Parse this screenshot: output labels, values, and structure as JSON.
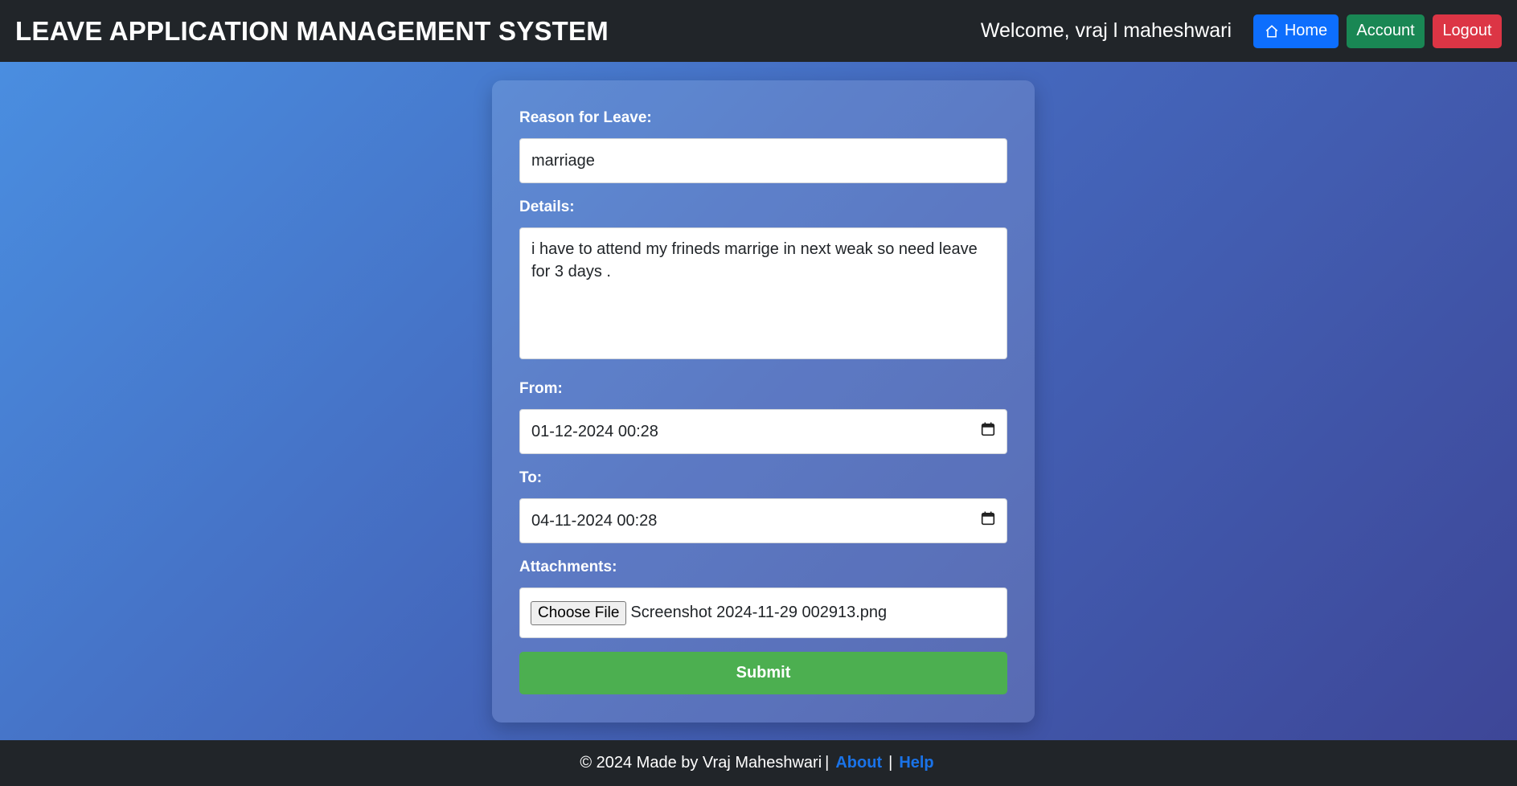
{
  "header": {
    "title": "LEAVE APPLICATION MANAGEMENT SYSTEM",
    "welcome": "Welcome, vraj l maheshwari",
    "home_label": "Home",
    "account_label": "Account",
    "logout_label": "Logout"
  },
  "form": {
    "reason_label": "Reason for Leave:",
    "reason_value": "marriage",
    "details_label": "Details:",
    "details_value": "i have to attend my frineds marrige in next weak so need leave for 3 days .",
    "from_label": "From:",
    "from_value": "01-12-2024 00:28",
    "to_label": "To:",
    "to_value": "04-11-2024 00:28",
    "attachments_label": "Attachments:",
    "choose_file_label": "Choose File",
    "file_name": "Screenshot 2024-11-29 002913.png",
    "submit_label": "Submit"
  },
  "footer": {
    "credit": "© 2024 Made by Vraj Maheshwari",
    "separator": "|",
    "about_label": "About",
    "help_label": "Help"
  },
  "colors": {
    "navbar": "#212529",
    "home": "#0d6efd",
    "account": "#198754",
    "logout": "#dc3545",
    "submit": "#4caf50",
    "link": "#1a73e8"
  },
  "icons": {
    "home": "home-icon",
    "date": "calendar-icon"
  }
}
